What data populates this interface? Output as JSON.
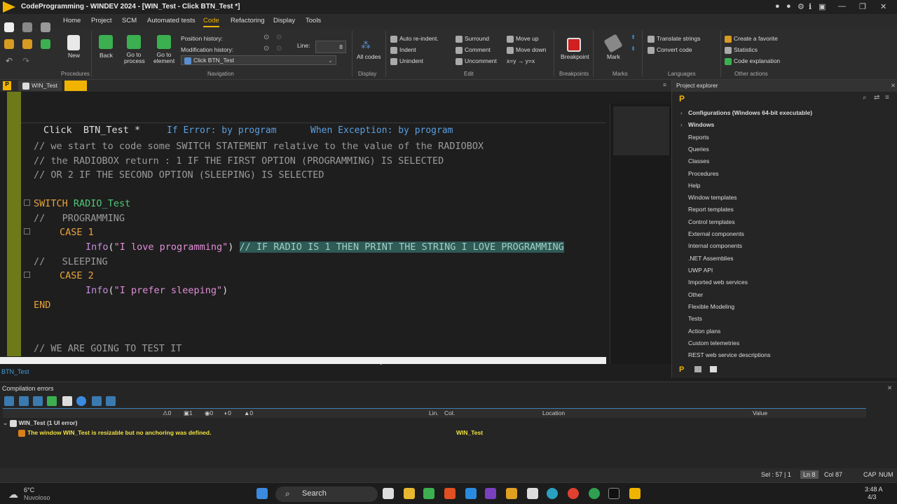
{
  "titlebar": {
    "title": "CodeProgramming - WINDEV 2024 - [WIN_Test - Click BTN_Test *]"
  },
  "menu": {
    "home": "Home",
    "project": "Project",
    "scm": "SCM",
    "automated_tests": "Automated tests",
    "code": "Code",
    "refactoring": "Refactoring",
    "display": "Display",
    "tools": "Tools"
  },
  "ribbon": {
    "procedures": {
      "new": "New",
      "label": "Procedures"
    },
    "navigation": {
      "back": "Back",
      "go_process": "Go to process",
      "go_element": "Go to element",
      "position_history": "Position history:",
      "modification_history": "Modification history:",
      "line_label": "Line:",
      "line_value": "8",
      "dropdown_value": "Click BTN_Test",
      "label": "Navigation"
    },
    "display": {
      "all_codes": "All codes",
      "label": "Display"
    },
    "edit": {
      "auto_reindent": "Auto re-indent.",
      "indent": "Indent",
      "unindent": "Unindent",
      "surround": "Surround",
      "comment": "Comment",
      "uncomment": "Uncomment",
      "move_up": "Move up",
      "move_down": "Move down",
      "swap": "x=y → y=x",
      "label": "Edit"
    },
    "breakpoints": {
      "breakpoint": "Breakpoint",
      "label": "Breakpoints"
    },
    "marks": {
      "mark": "Mark",
      "label": "Marks"
    },
    "languages": {
      "translate": "Translate strings",
      "convert": "Convert code",
      "label": "Languages"
    },
    "other": {
      "favorite": "Create a favorite",
      "statistics": "Statistics",
      "explanation": "Code explanation",
      "label": "Other actions"
    }
  },
  "tabs": {
    "win_test": "WIN_Test"
  },
  "editor": {
    "header_event": "Click  BTN_Test *",
    "header_error": "If Error: by program",
    "header_exception": "When Exception: by program",
    "line1": "// we start to code some SWITCH STATEMENT relative to the value of the RADIOBOX",
    "line2": "// the RADIOBOX return : 1 IF THE FIRST OPTION (PROGRAMMING) IS SELECTED",
    "line3": "// OR 2 IF THE SECOND OPTION (SLEEPING) IS SELECTED",
    "switch_kw": "SWITCH",
    "switch_var": "RADIO_Test",
    "cmt_programming": "//   PROGRAMMING",
    "case_kw": "CASE",
    "case1_num": "1",
    "info_fn": "Info",
    "info1_open": "(",
    "info1_str": "\"I love programming\"",
    "info1_close": ")",
    "info1_comment": "// IF RADIO IS 1 THEN PRINT THE STRING I LOVE PROGRAMMING",
    "cmt_sleeping": "//   SLEEPING",
    "case2_num": "2",
    "info2_str": "\"I prefer sleeping\"",
    "end_kw": "END",
    "line_test": "// WE ARE GOING TO TEST IT"
  },
  "explorer": {
    "title": "Project explorer",
    "configurations": "Configurations (Windows 64-bit executable)",
    "windows": "Windows",
    "items": [
      "Reports",
      "Queries",
      "Classes",
      "Procedures",
      "Help",
      "Window templates",
      "Report templates",
      "Control templates",
      "External components",
      "Internal components",
      ".NET Assemblies",
      "UWP API",
      "Imported web services",
      "Other",
      "Flexible Modeling",
      "Tests",
      "Action plans",
      "Custom telemetries",
      "REST web service descriptions"
    ]
  },
  "winname": "BTN_Test",
  "compilation": {
    "title": "Compilation errors",
    "counts": [
      "0",
      "1",
      "0",
      "0",
      "0"
    ],
    "col_lin": "Lin.",
    "col_col": "Col.",
    "col_location": "Location",
    "col_value": "Value",
    "group": "WIN_Test (1 UI error)",
    "message": "The window WIN_Test is resizable but no anchoring was defined.",
    "location": "WIN_Test"
  },
  "status": {
    "sel": "Sel : 57 | 1",
    "ln": "Ln 8",
    "col": "Col 87",
    "cap": "CAP",
    "num": "NUM"
  },
  "taskbar": {
    "temp": "6°C",
    "weather": "Nuvoloso",
    "search": "Search",
    "time": "3:48 A",
    "date": "4/3"
  }
}
